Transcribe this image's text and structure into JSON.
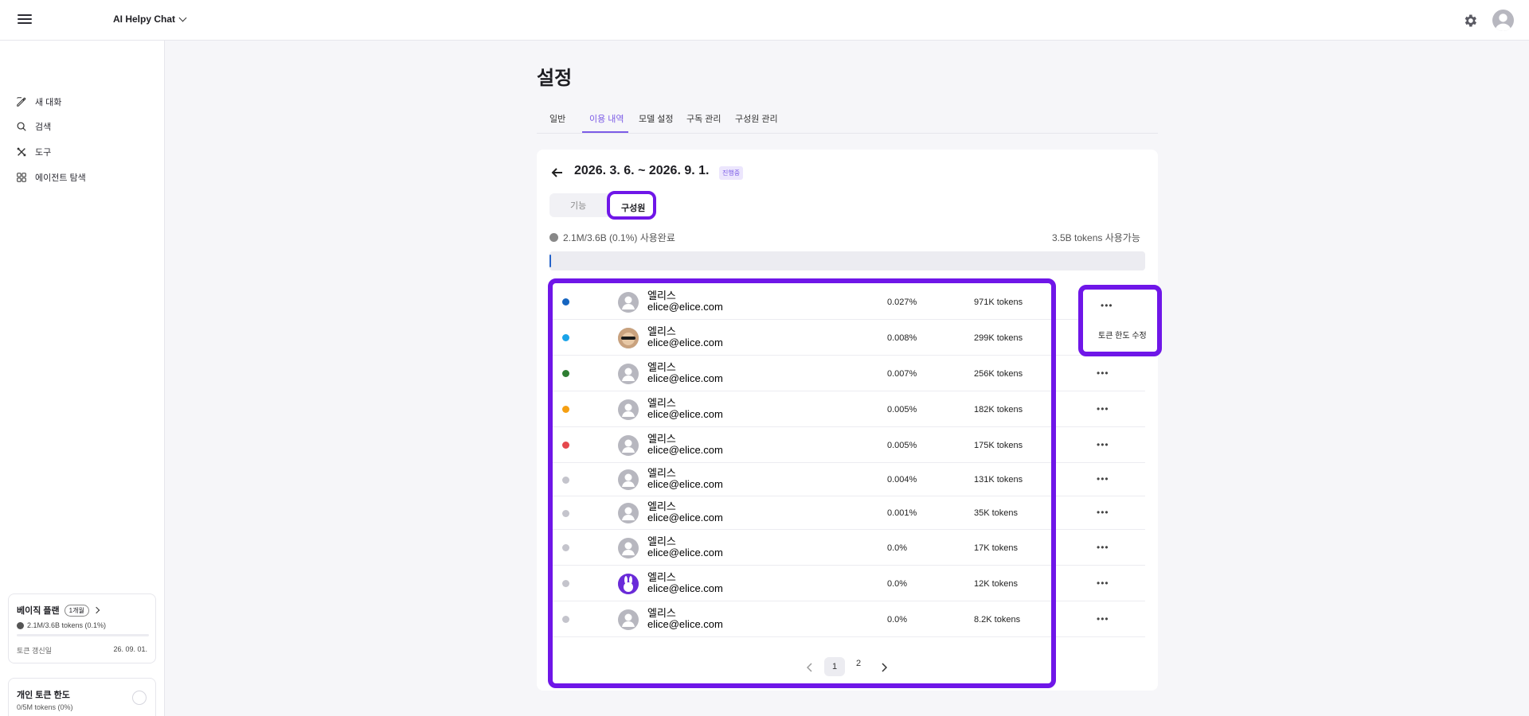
{
  "app": {
    "title": "AI Helpy Chat"
  },
  "sidebar": {
    "items": [
      {
        "label": "새 대화",
        "icon": "edit-icon"
      },
      {
        "label": "검색",
        "icon": "search-icon"
      },
      {
        "label": "도구",
        "icon": "tools-icon"
      },
      {
        "label": "에이전트 탐색",
        "icon": "grid-icon"
      }
    ],
    "plan": {
      "title": "베이직 플랜",
      "badge": "1개월",
      "tokens": "2.1M/3.6B tokens (0.1%)",
      "renew_label": "토큰 갱신일",
      "renew_date": "26. 09. 01."
    },
    "limit": {
      "title": "개인 토큰 한도",
      "value": "0/5M tokens (0%)"
    }
  },
  "page": {
    "title": "설정",
    "tabs": [
      "일반",
      "이용 내역",
      "모델 설정",
      "구독 관리",
      "구성원 관리"
    ],
    "active_tab": "이용 내역"
  },
  "usage": {
    "period": "2026. 3. 6. ~ 2026. 9. 1.",
    "status": "진행중",
    "segments": [
      "기능",
      "구성원"
    ],
    "active_segment": "구성원",
    "used_text": "2.1M/3.6B (0.1%) 사용완료",
    "available_text": "3.5B tokens 사용가능",
    "used_fraction": 0.001
  },
  "members": [
    {
      "name": "엘리스",
      "email": "elice@elice.com",
      "percent": "0.027%",
      "tokens": "971K tokens",
      "color": "#1565c0"
    },
    {
      "name": "엘리스",
      "email": "elice@elice.com",
      "percent": "0.008%",
      "tokens": "299K tokens",
      "color": "#1aa3e8"
    },
    {
      "name": "엘리스",
      "email": "elice@elice.com",
      "percent": "0.007%",
      "tokens": "256K tokens",
      "color": "#2e7d32"
    },
    {
      "name": "엘리스",
      "email": "elice@elice.com",
      "percent": "0.005%",
      "tokens": "182K tokens",
      "color": "#f59f12"
    },
    {
      "name": "엘리스",
      "email": "elice@elice.com",
      "percent": "0.005%",
      "tokens": "175K tokens",
      "color": "#e5484d"
    },
    {
      "name": "엘리스",
      "email": "elice@elice.com",
      "percent": "0.004%",
      "tokens": "131K tokens",
      "color": "#c4c4cc"
    },
    {
      "name": "엘리스",
      "email": "elice@elice.com",
      "percent": "0.001%",
      "tokens": "35K tokens",
      "color": "#c4c4cc"
    },
    {
      "name": "엘리스",
      "email": "elice@elice.com",
      "percent": "0.0%",
      "tokens": "17K tokens",
      "color": "#c4c4cc"
    },
    {
      "name": "엘리스",
      "email": "elice@elice.com",
      "percent": "0.0%",
      "tokens": "12K tokens",
      "color": "#c4c4cc"
    },
    {
      "name": "엘리스",
      "email": "elice@elice.com",
      "percent": "0.0%",
      "tokens": "8.2K tokens",
      "color": "#c4c4cc"
    }
  ],
  "row_menu": {
    "more": "•••",
    "item": "토큰 한도 수정"
  },
  "pagination": {
    "pages": [
      "1",
      "2"
    ],
    "current": "1"
  }
}
